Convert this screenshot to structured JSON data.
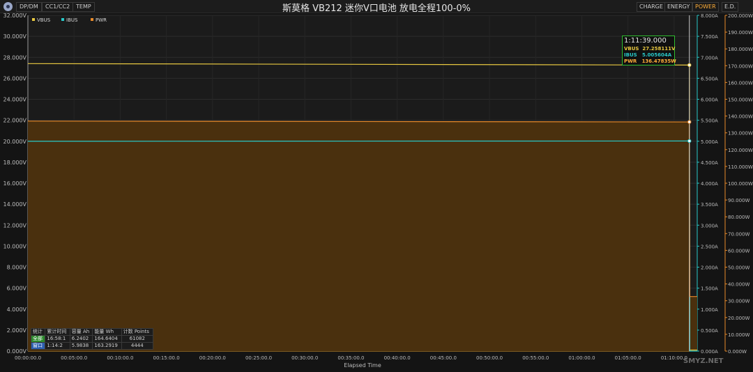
{
  "header": {
    "title": "斯莫格 VB212 迷你V口电池 放电全程100-0%",
    "left_tabs": [
      "DP/DM",
      "CC1/CC2",
      "TEMP"
    ],
    "right_tabs": [
      "CHARGE",
      "ENERGY",
      "POWER",
      "E.D."
    ],
    "active_tab": "POWER",
    "logo_icon": "app-logo-icon"
  },
  "chart_data": {
    "type": "line",
    "xlabel": "Elapsed Time",
    "x_ticks": [
      "00:00:00.0",
      "00:05:00.0",
      "00:10:00.0",
      "00:15:00.0",
      "00:20:00.0",
      "00:25:00.0",
      "00:30:00.0",
      "00:35:00.0",
      "00:40:00.0",
      "00:45:00.0",
      "00:50:00.0",
      "00:55:00.0",
      "01:00:00.0",
      "01:05:00.0",
      "01:10:00.0"
    ],
    "x_range_minutes": [
      0,
      72.5
    ],
    "axes": {
      "left": {
        "unit": "V",
        "range": [
          0,
          32
        ],
        "ticks": [
          "0.000V",
          "2.000V",
          "4.000V",
          "6.000V",
          "8.000V",
          "10.000V",
          "12.000V",
          "14.000V",
          "16.000V",
          "18.000V",
          "20.000V",
          "22.000V",
          "24.000V",
          "26.000V",
          "28.000V",
          "30.000V",
          "32.000V"
        ]
      },
      "right1": {
        "unit": "A",
        "range": [
          0,
          8
        ],
        "ticks": [
          "0.000A",
          "0.500A",
          "1.000A",
          "1.500A",
          "2.000A",
          "2.500A",
          "3.000A",
          "3.500A",
          "4.000A",
          "4.500A",
          "5.000A",
          "5.500A",
          "6.000A",
          "6.500A",
          "7.000A",
          "7.500A",
          "8.000A"
        ]
      },
      "right2": {
        "unit": "W",
        "range": [
          0,
          200
        ],
        "ticks": [
          "0.000W",
          "10.000W",
          "20.000W",
          "30.000W",
          "40.000W",
          "50.000W",
          "60.000W",
          "70.000W",
          "80.000W",
          "90.000W",
          "100.000W",
          "110.000W",
          "120.000W",
          "130.000W",
          "140.000W",
          "150.000W",
          "160.000W",
          "170.000W",
          "180.000W",
          "190.000W",
          "200.000W"
        ]
      }
    },
    "series": [
      {
        "name": "VBUS",
        "color": "#e8c840",
        "axis": "left",
        "points": [
          [
            0,
            27.4
          ],
          [
            71.65,
            27.26
          ],
          [
            71.7,
            0.1
          ],
          [
            72.5,
            0.1
          ]
        ]
      },
      {
        "name": "IBUS",
        "color": "#28c8c8",
        "axis": "right1",
        "points": [
          [
            0,
            5.0
          ],
          [
            71.65,
            5.006
          ],
          [
            71.7,
            0.0
          ],
          [
            72.5,
            0.0
          ]
        ]
      },
      {
        "name": "PWR",
        "color": "#e88a2a",
        "axis": "right2",
        "fill": "#4a300e",
        "points": [
          [
            0,
            137.0
          ],
          [
            71.65,
            136.48
          ],
          [
            71.7,
            32.5
          ],
          [
            72.5,
            32.5
          ]
        ]
      }
    ],
    "grid": true,
    "legend": "top-left",
    "cursor": {
      "x_minutes": 71.65,
      "time": "1:11:39.000",
      "rows": [
        {
          "label": "VBUS",
          "value": "27.258111V",
          "color": "#e8c840"
        },
        {
          "label": "IBUS",
          "value": "5.005604A",
          "color": "#28c8c8"
        },
        {
          "label": "PWR",
          "value": "136.47835W",
          "color": "#ffae3a"
        }
      ]
    }
  },
  "stats": {
    "headers": [
      "统计",
      "累计时间",
      "容量 Ah",
      "能量 Wh",
      "计数 Points"
    ],
    "rows": [
      [
        "全部",
        "16:58:1",
        "6.2402",
        "164.6404",
        "61082"
      ],
      [
        "窗口",
        "1:14:2",
        "5.9838",
        "163.2919",
        "4444"
      ]
    ]
  },
  "watermark": "SMYZ.NET"
}
